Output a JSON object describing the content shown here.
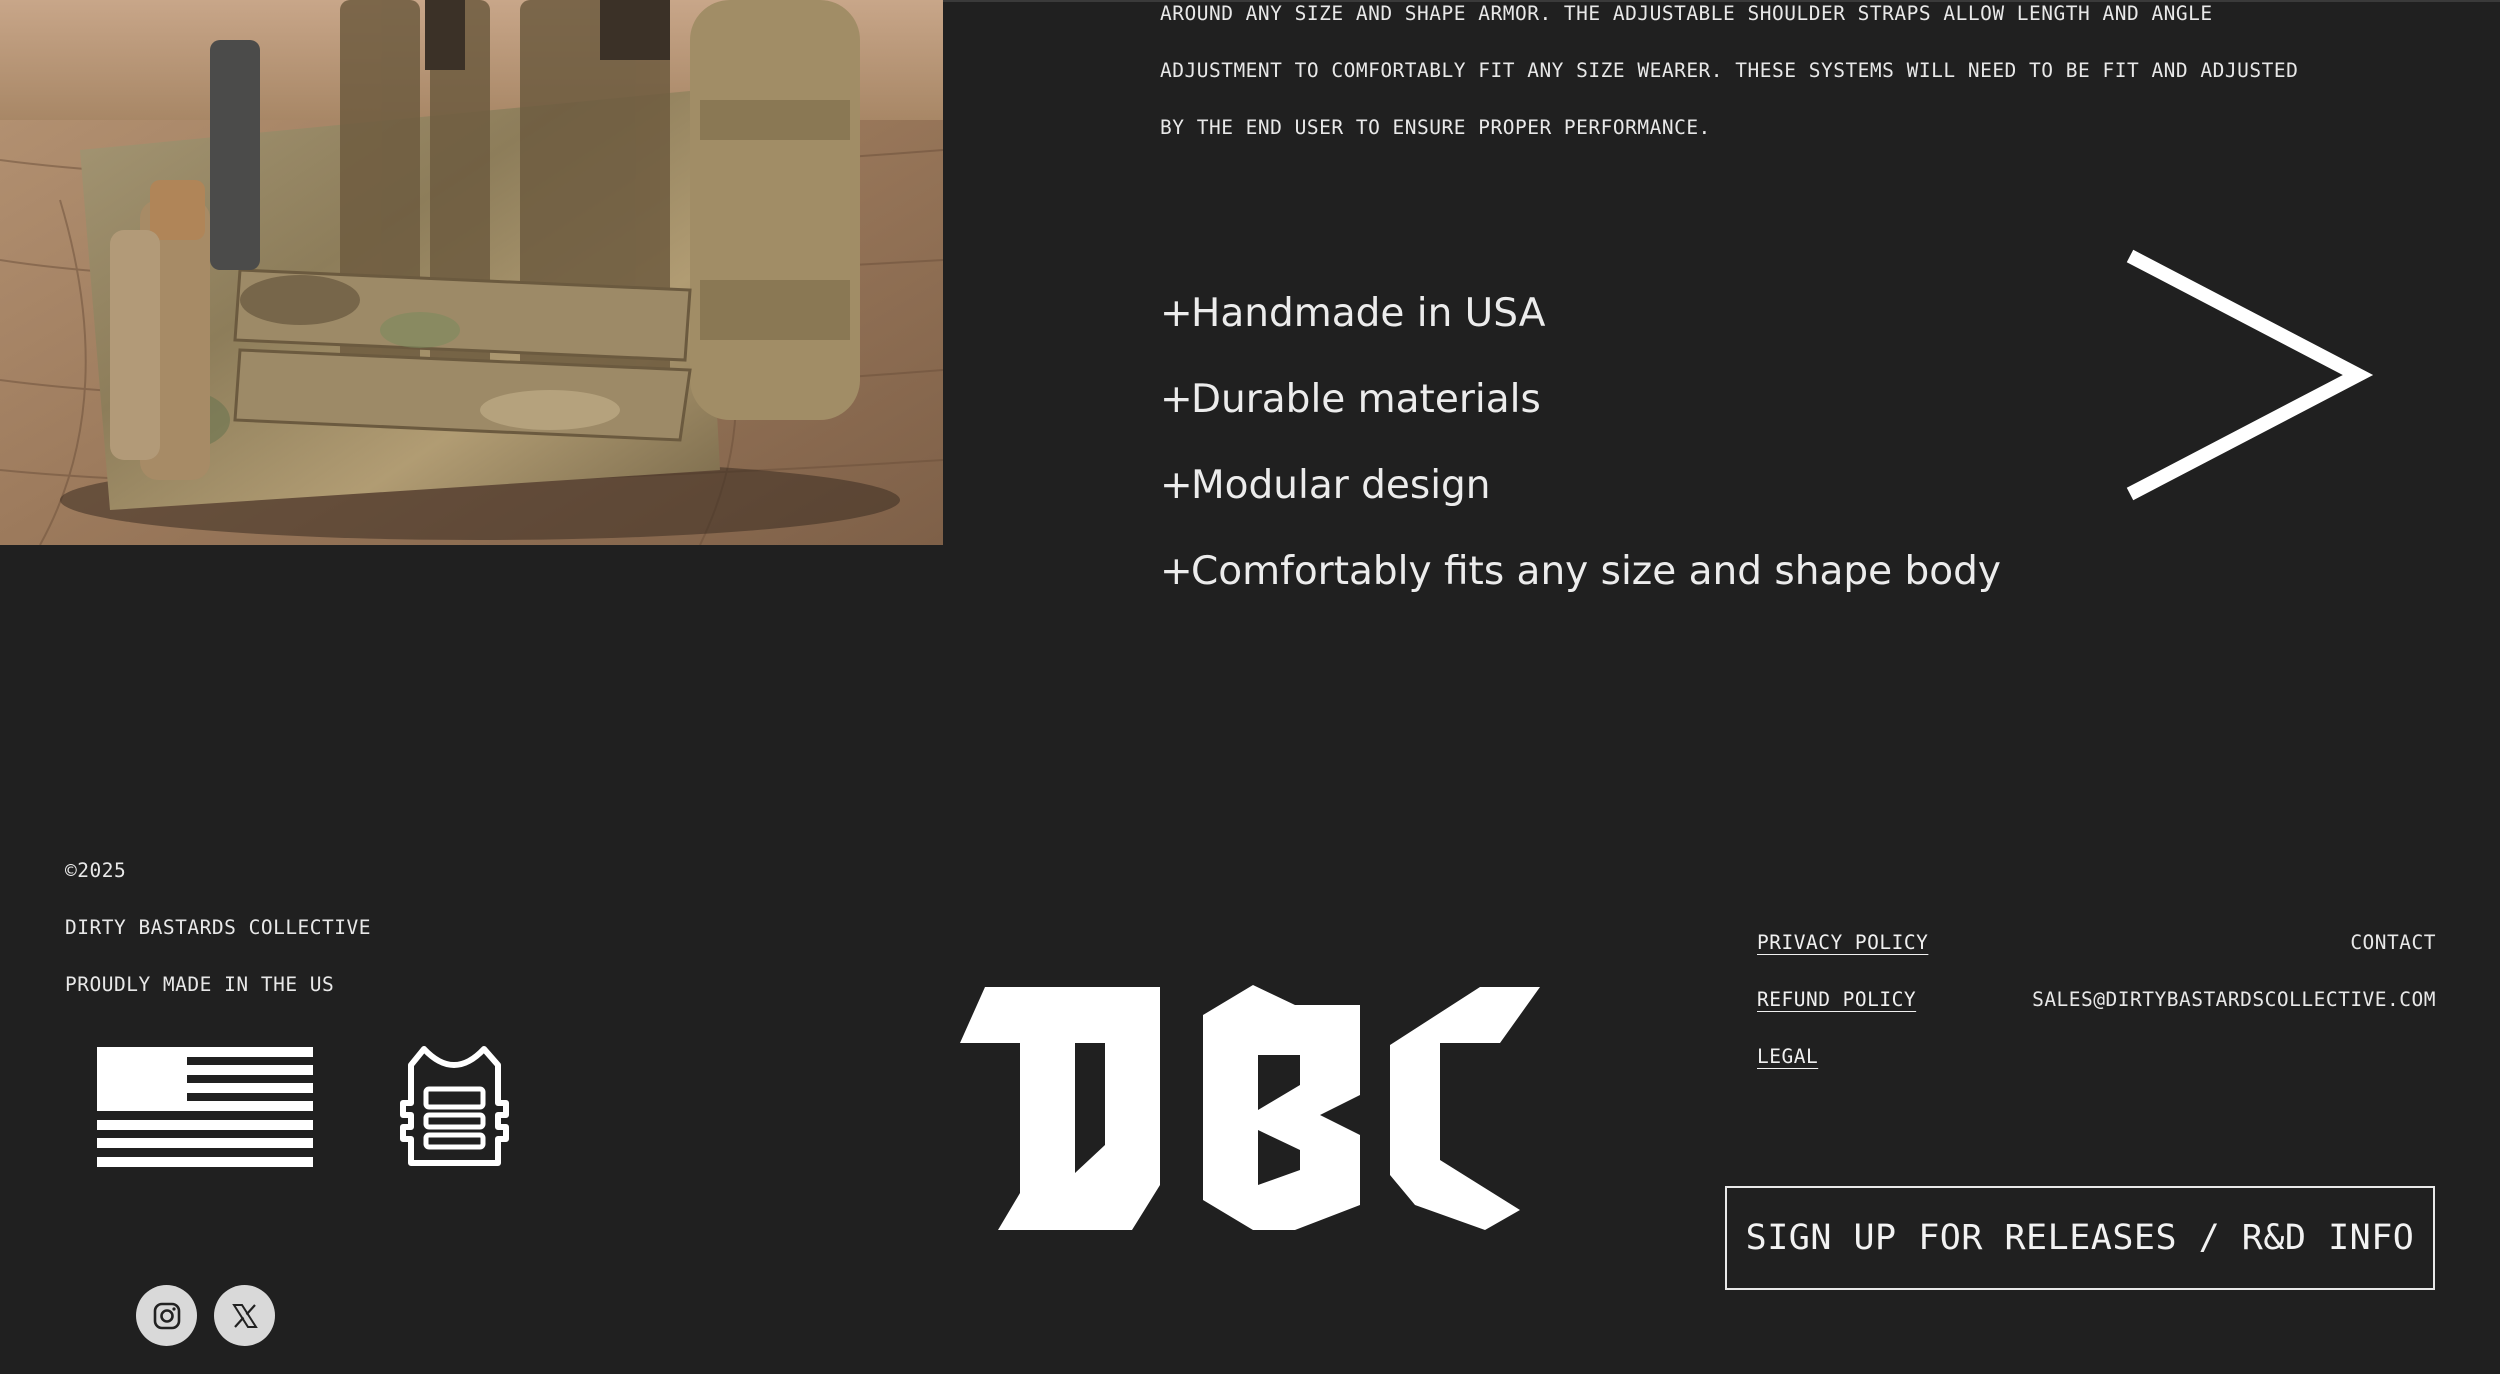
{
  "product": {
    "description_lines": [
      "AROUND ANY SIZE AND SHAPE ARMOR. THE ADJUSTABLE SHOULDER STRAPS ALLOW LENGTH AND ANGLE",
      "ADJUSTMENT TO COMFORTABLY FIT ANY SIZE WEARER. THESE SYSTEMS WILL NEED TO BE FIT AND ADJUSTED",
      "BY THE END USER TO ENSURE PROPER PERFORMANCE."
    ],
    "features": [
      {
        "prefix": "+",
        "text": "Handmade in USA"
      },
      {
        "prefix": "+",
        "text": "Durable materials"
      },
      {
        "prefix": "+",
        "text": "Modular design"
      },
      {
        "prefix": "+",
        "text": "Comfortably fits any size and shape body"
      }
    ],
    "next_icon": "chevron-right-icon"
  },
  "footer": {
    "copyright": "©2025",
    "company": "DIRTY BASTARDS COLLECTIVE",
    "tagline": "PROUDLY MADE IN THE US",
    "logo_text": "DBC",
    "links": {
      "privacy": "PRIVACY POLICY",
      "refund": "REFUND POLICY",
      "legal": "LEGAL"
    },
    "contact": {
      "label": "CONTACT",
      "email": "SALES@DIRTYBASTARDSCOLLECTIVE.COM"
    },
    "signup_label": "SIGN UP FOR RELEASES / R&D INFO",
    "social": [
      "instagram-icon",
      "x-twitter-icon"
    ]
  },
  "colors": {
    "background": "#202020",
    "text": "#f0f0f0",
    "social_bg": "#d9d9d9"
  }
}
